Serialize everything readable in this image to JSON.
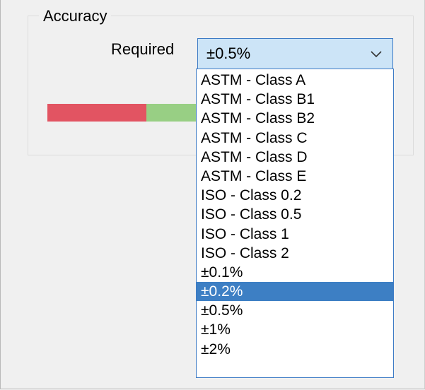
{
  "group": {
    "title": "Accuracy"
  },
  "required": {
    "label": "Required",
    "selected_value": "±0.5%",
    "arrow_icon": "chevron-down-icon"
  },
  "accuracy_bar": {
    "colors": {
      "red": "#e25462",
      "green": "#98cf84"
    }
  },
  "dropdown": {
    "highlighted_index": 11,
    "options": [
      "ASTM - Class A",
      "ASTM - Class B1",
      "ASTM - Class B2",
      "ASTM - Class C",
      "ASTM - Class D",
      "ASTM - Class E",
      "ISO - Class 0.2",
      "ISO - Class 0.5",
      "ISO - Class 1",
      "ISO - Class 2",
      "±0.1%",
      "±0.2%",
      "±0.5%",
      "±1%",
      "±2%"
    ]
  },
  "colors": {
    "accent": "#3d7bc5",
    "combo_background": "#cce4f7",
    "highlight": "#3d7fc4"
  }
}
